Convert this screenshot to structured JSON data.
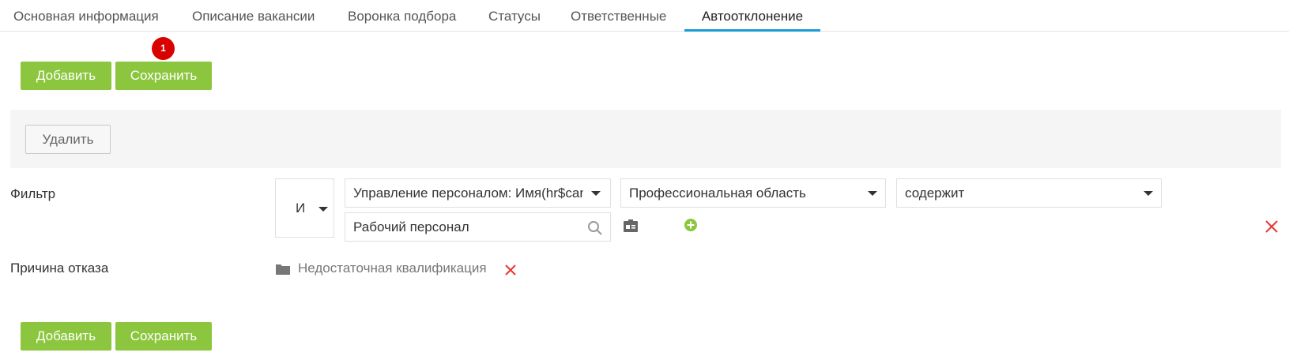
{
  "tabs": [
    {
      "label": "Основная информация"
    },
    {
      "label": "Описание вакансии"
    },
    {
      "label": "Воронка подбора"
    },
    {
      "label": "Статусы"
    },
    {
      "label": "Ответственные"
    },
    {
      "label": "Автоотклонение",
      "active": true
    }
  ],
  "toolbar_top": {
    "add_label": "Добавить",
    "save_label": "Сохранить",
    "save_badge": "1"
  },
  "rule": {
    "delete_label": "Удалить",
    "filter_label": "Фильтр",
    "operator": "И",
    "field_source": "Управление персоналом: Имя(hr$candidate)",
    "field": "Профессиональная область",
    "condition": "содержит",
    "value": "Рабочий персонал",
    "reason_label": "Причина отказа",
    "reason_value": "Недостаточная квалификация"
  },
  "toolbar_bottom": {
    "add_label": "Добавить",
    "save_label": "Сохранить"
  },
  "colors": {
    "accent_green": "#8cc63f",
    "tab_underline": "#1a9ad6",
    "danger": "#e53935",
    "badge": "#d90000"
  },
  "icons": {
    "search": "search-icon",
    "card": "id-card-icon",
    "add": "plus-circle-icon",
    "remove": "close-icon",
    "folder": "folder-icon"
  }
}
